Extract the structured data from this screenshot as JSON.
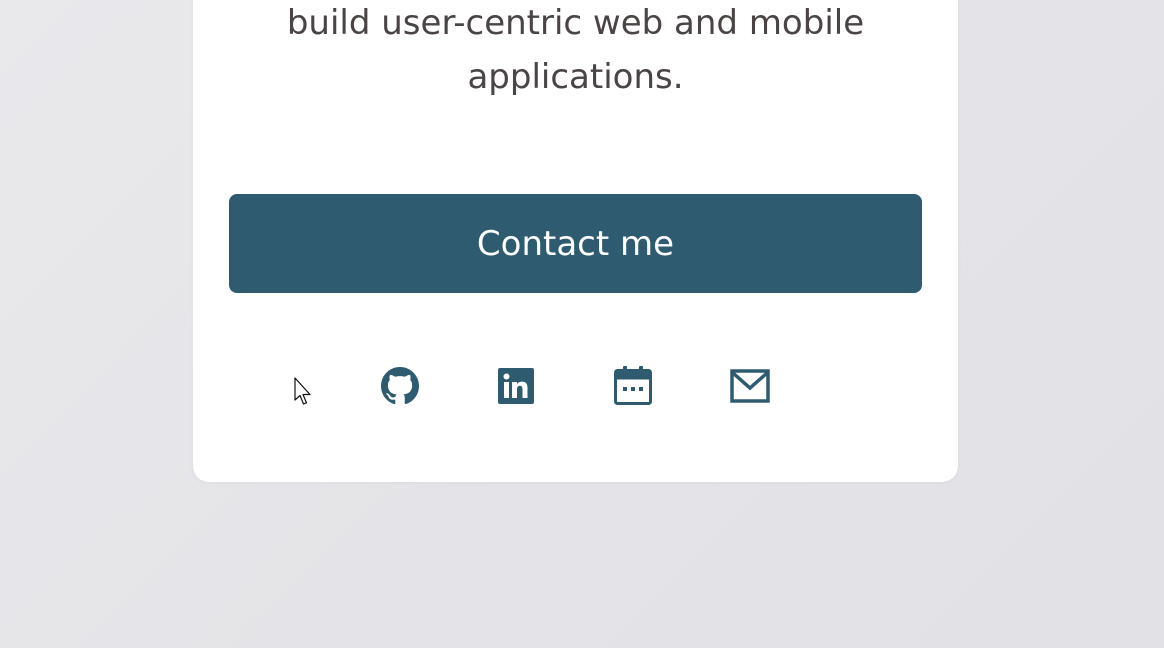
{
  "intro": {
    "line1": "build user-centric web and mobile",
    "line2": "applications."
  },
  "contact": {
    "label": "Contact me"
  },
  "socials": [
    {
      "icon": "github-icon"
    },
    {
      "icon": "linkedin-icon"
    },
    {
      "icon": "calendar-icon"
    },
    {
      "icon": "mail-icon"
    }
  ],
  "colors": {
    "accent": "#2e5b70",
    "text": "#4a4444",
    "card": "#ffffff",
    "background": "#e4e4e8"
  }
}
